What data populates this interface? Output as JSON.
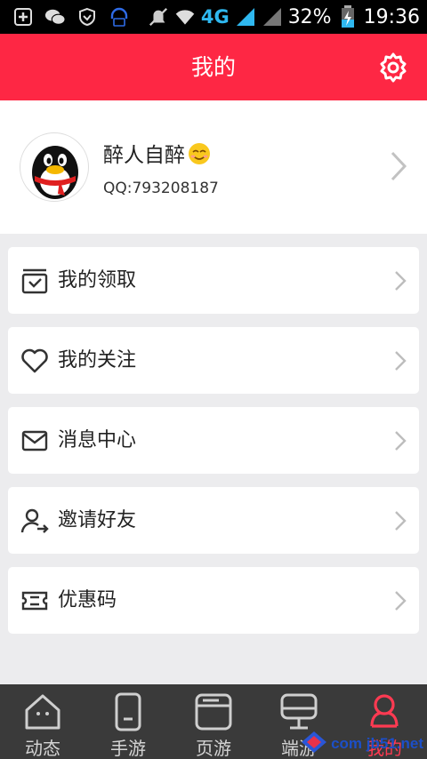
{
  "status_bar": {
    "network": "4G",
    "battery": "32%",
    "time": "19:36"
  },
  "header": {
    "title": "我的",
    "settings_icon": "gear-icon"
  },
  "profile": {
    "nickname": "醉人自醉",
    "qq": "QQ:793208187",
    "emoji": "smiling-face-icon"
  },
  "menu": [
    {
      "label": "我的领取",
      "icon": "inbox-check-icon"
    },
    {
      "label": "我的关注",
      "icon": "heart-icon"
    },
    {
      "label": "消息中心",
      "icon": "envelope-icon"
    },
    {
      "label": "邀请好友",
      "icon": "invite-user-icon"
    },
    {
      "label": "优惠码",
      "icon": "ticket-icon"
    }
  ],
  "tabs": [
    {
      "label": "动态",
      "icon": "home-icon",
      "active": false
    },
    {
      "label": "手游",
      "icon": "phone-icon",
      "active": false
    },
    {
      "label": "页游",
      "icon": "browser-icon",
      "active": false
    },
    {
      "label": "端游",
      "icon": "monitor-icon",
      "active": false
    },
    {
      "label": "我的",
      "icon": "user-icon",
      "active": true
    }
  ],
  "watermark": {
    "text": "com jb51.net"
  },
  "colors": {
    "accent": "#fe2744",
    "tabbar": "#3a3a3a",
    "page_bg": "#ececee"
  }
}
